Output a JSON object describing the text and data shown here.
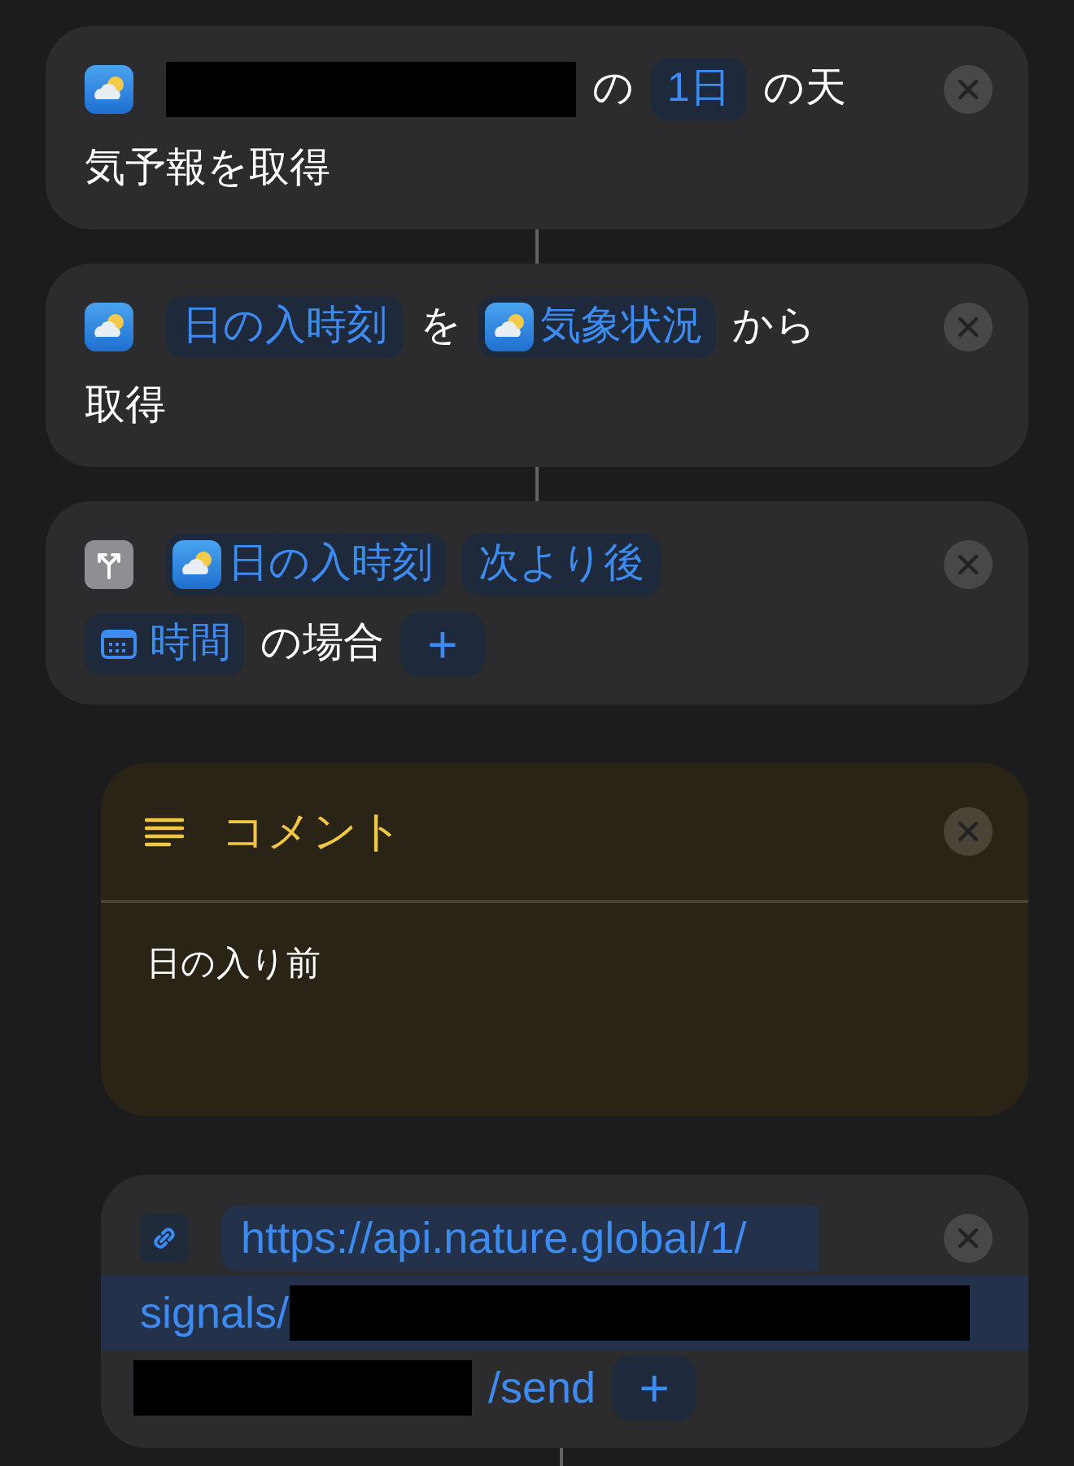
{
  "actions": [
    {
      "kind": "action",
      "lines": [
        [
          {
            "kind": "redacted"
          },
          {
            "kind": "text",
            "text": "の"
          },
          {
            "kind": "token",
            "text": "1日"
          },
          {
            "kind": "text",
            "text": "の天"
          }
        ],
        [
          {
            "kind": "text",
            "text": "気予報を取得"
          }
        ]
      ]
    },
    {
      "kind": "action",
      "lines": [
        [
          {
            "kind": "token",
            "text": "日の入時刻"
          },
          {
            "kind": "text",
            "text": "を"
          },
          {
            "kind": "weather_token",
            "text": "気象状況"
          },
          {
            "kind": "text",
            "text": "から"
          }
        ],
        [
          {
            "kind": "text",
            "text": "取得"
          }
        ]
      ]
    },
    {
      "kind": "if",
      "lines": [
        [
          {
            "kind": "weather_token",
            "text": "日の入時刻"
          },
          {
            "kind": "token",
            "text": "次より後"
          }
        ],
        [
          {
            "kind": "calendar_token",
            "text": "時間"
          },
          {
            "kind": "text",
            "text": "の場合"
          },
          {
            "kind": "plus",
            "text": "+"
          }
        ]
      ]
    },
    {
      "kind": "comment",
      "title": "コメント",
      "body": "日の入り前"
    },
    {
      "kind": "url",
      "lines": [
        [
          {
            "kind": "urltext",
            "text": "https://api.nature.global/1/"
          }
        ],
        [
          {
            "kind": "urltext",
            "text": "signals/"
          },
          {
            "kind": "redacted"
          }
        ],
        [
          {
            "kind": "redacted"
          },
          {
            "kind": "urltext",
            "text": "/send"
          },
          {
            "kind": "plus",
            "text": "+"
          }
        ]
      ]
    }
  ]
}
